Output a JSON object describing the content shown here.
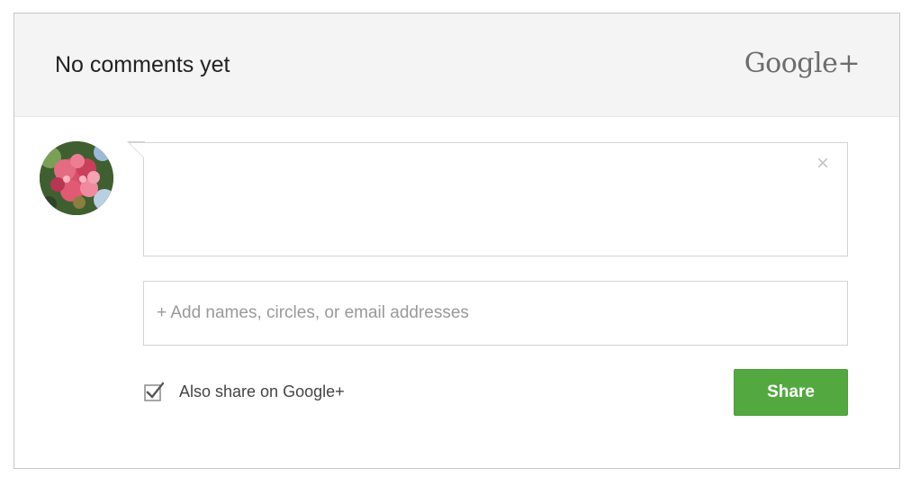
{
  "header": {
    "title": "No comments yet",
    "brand": "Google+"
  },
  "avatar": {
    "icon": "user-avatar-flowers"
  },
  "comment": {
    "value": "",
    "clear_icon": "close-icon",
    "clear_glyph": "×"
  },
  "recipients": {
    "placeholder": "+ Add names, circles, or email addresses",
    "value": ""
  },
  "share_option": {
    "label": "Also share on Google+",
    "checked": true,
    "icon": "checkbox-checked-icon"
  },
  "share_button": {
    "label": "Share",
    "color": "#53a93f"
  }
}
